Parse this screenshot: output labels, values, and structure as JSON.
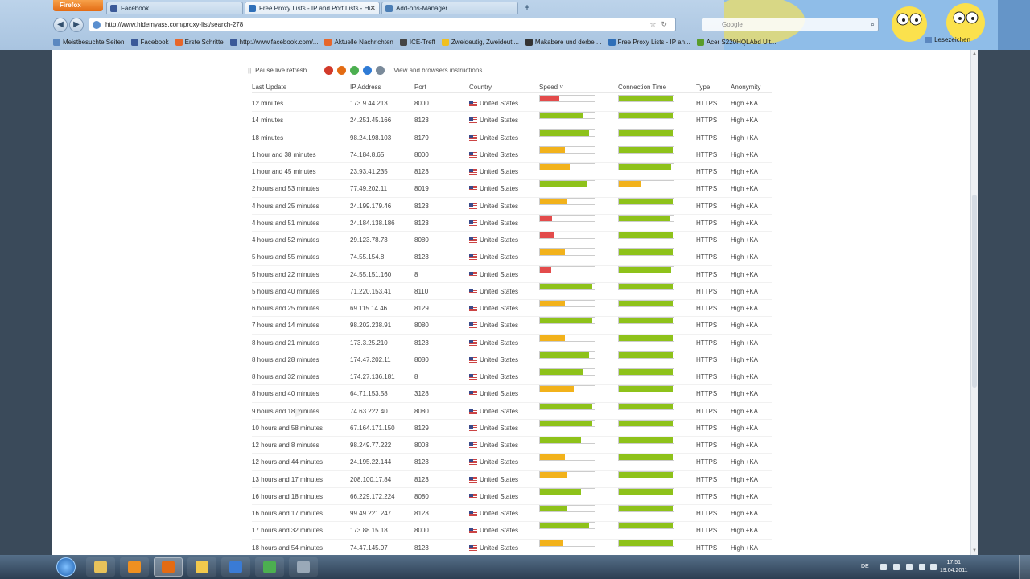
{
  "browser": {
    "app_button": "Firefox",
    "tabs": [
      {
        "label": "Facebook",
        "color": "#3b5998",
        "active": false
      },
      {
        "label": "Free Proxy Lists - IP and Port Lists - Hi...",
        "color": "#2f6fb8",
        "active": true
      },
      {
        "label": "Add-ons-Manager",
        "color": "#4a7db5",
        "active": false
      }
    ],
    "new_tab": "+",
    "url": "http://www.hidemyass.com/proxy-list/search-278",
    "search_placeholder": "Google",
    "back": "◀",
    "forward": "▶",
    "reload": "↻",
    "bookmarks": [
      {
        "label": "Meistbesuchte Seiten",
        "color": "#5b88c0"
      },
      {
        "label": "Facebook",
        "color": "#3b5998"
      },
      {
        "label": "Erste Schritte",
        "color": "#e7662a"
      },
      {
        "label": "http://www.facebook.com/...",
        "color": "#3b5998"
      },
      {
        "label": "Aktuelle Nachrichten",
        "color": "#e7662a"
      },
      {
        "label": "ICE-Treff",
        "color": "#444444"
      },
      {
        "label": "Zweideutig, Zweideuti...",
        "color": "#f0c020"
      },
      {
        "label": "Makabere und derbe ...",
        "color": "#333333"
      },
      {
        "label": "Free Proxy Lists - IP an...",
        "color": "#2f6fb8"
      },
      {
        "label": "Acer S220HQLAbd Ult...",
        "color": "#5a9c2a"
      }
    ],
    "bookmarks_right": "Lesezeichen",
    "theme_title": "The Simpsons"
  },
  "page": {
    "controls": {
      "pause_label": "Pause live refresh",
      "view_label": "View and browsers instructions"
    },
    "columns": [
      "Last Update",
      "IP Address",
      "Port",
      "Country",
      "Speed",
      "Connection Time",
      "Type",
      "Anonymity"
    ],
    "speed_sort_indicator": "Speed ˅",
    "rows": [
      {
        "update": "12 minutes",
        "ip": "173.9.44.213",
        "port": "8000",
        "country": "United States",
        "speed": 0.35,
        "speed_color": "#e34b4b",
        "conn": 0.98,
        "conn_color": "#8ec21a",
        "type": "HTTPS",
        "anon": "High +KA"
      },
      {
        "update": "14 minutes",
        "ip": "24.251.45.166",
        "port": "8123",
        "country": "United States",
        "speed": 0.78,
        "speed_color": "#8ec21a",
        "conn": 0.98,
        "conn_color": "#8ec21a",
        "type": "HTTPS",
        "anon": "High +KA"
      },
      {
        "update": "18 minutes",
        "ip": "98.24.198.103",
        "port": "8179",
        "country": "United States",
        "speed": 0.9,
        "speed_color": "#8ec21a",
        "conn": 0.98,
        "conn_color": "#8ec21a",
        "type": "HTTPS",
        "anon": "High +KA"
      },
      {
        "update": "1 hour and 38 minutes",
        "ip": "74.184.8.65",
        "port": "8000",
        "country": "United States",
        "speed": 0.45,
        "speed_color": "#f2b21b",
        "conn": 0.98,
        "conn_color": "#8ec21a",
        "type": "HTTPS",
        "anon": "High +KA"
      },
      {
        "update": "1 hour and 45 minutes",
        "ip": "23.93.41.235",
        "port": "8123",
        "country": "United States",
        "speed": 0.55,
        "speed_color": "#f2b21b",
        "conn": 0.95,
        "conn_color": "#8ec21a",
        "type": "HTTPS",
        "anon": "High +KA"
      },
      {
        "update": "2 hours and 53 minutes",
        "ip": "77.49.202.11",
        "port": "8019",
        "country": "United States",
        "speed": 0.85,
        "speed_color": "#8ec21a",
        "conn": 0.4,
        "conn_color": "#f2b21b",
        "type": "HTTPS",
        "anon": "High +KA"
      },
      {
        "update": "4 hours and 25 minutes",
        "ip": "24.199.179.46",
        "port": "8123",
        "country": "United States",
        "speed": 0.48,
        "speed_color": "#f2b21b",
        "conn": 0.98,
        "conn_color": "#8ec21a",
        "type": "HTTPS",
        "anon": "High +KA"
      },
      {
        "update": "4 hours and 51 minutes",
        "ip": "24.184.138.186",
        "port": "8123",
        "country": "United States",
        "speed": 0.22,
        "speed_color": "#e34b4b",
        "conn": 0.92,
        "conn_color": "#8ec21a",
        "type": "HTTPS",
        "anon": "High +KA"
      },
      {
        "update": "4 hours and 52 minutes",
        "ip": "29.123.78.73",
        "port": "8080",
        "country": "United States",
        "speed": 0.25,
        "speed_color": "#e34b4b",
        "conn": 0.98,
        "conn_color": "#8ec21a",
        "type": "HTTPS",
        "anon": "High +KA"
      },
      {
        "update": "5 hours and 55 minutes",
        "ip": "74.55.154.8",
        "port": "8123",
        "country": "United States",
        "speed": 0.45,
        "speed_color": "#f2b21b",
        "conn": 0.98,
        "conn_color": "#8ec21a",
        "type": "HTTPS",
        "anon": "High +KA"
      },
      {
        "update": "5 hours and 22 minutes",
        "ip": "24.55.151.160",
        "port": "8",
        "country": "United States",
        "speed": 0.2,
        "speed_color": "#e34b4b",
        "conn": 0.95,
        "conn_color": "#8ec21a",
        "type": "HTTPS",
        "anon": "High +KA"
      },
      {
        "update": "5 hours and 40 minutes",
        "ip": "71.220.153.41",
        "port": "8110",
        "country": "United States",
        "speed": 0.95,
        "speed_color": "#8ec21a",
        "conn": 0.98,
        "conn_color": "#8ec21a",
        "type": "HTTPS",
        "anon": "High +KA"
      },
      {
        "update": "6 hours and 25 minutes",
        "ip": "69.115.14.46",
        "port": "8129",
        "country": "United States",
        "speed": 0.45,
        "speed_color": "#f2b21b",
        "conn": 0.98,
        "conn_color": "#8ec21a",
        "type": "HTTPS",
        "anon": "High +KA"
      },
      {
        "update": "7 hours and 14 minutes",
        "ip": "98.202.238.91",
        "port": "8080",
        "country": "United States",
        "speed": 0.95,
        "speed_color": "#8ec21a",
        "conn": 0.98,
        "conn_color": "#8ec21a",
        "type": "HTTPS",
        "anon": "High +KA"
      },
      {
        "update": "8 hours and 21 minutes",
        "ip": "173.3.25.210",
        "port": "8123",
        "country": "United States",
        "speed": 0.45,
        "speed_color": "#f2b21b",
        "conn": 0.98,
        "conn_color": "#8ec21a",
        "type": "HTTPS",
        "anon": "High +KA"
      },
      {
        "update": "8 hours and 28 minutes",
        "ip": "174.47.202.11",
        "port": "8080",
        "country": "United States",
        "speed": 0.9,
        "speed_color": "#8ec21a",
        "conn": 0.98,
        "conn_color": "#8ec21a",
        "type": "HTTPS",
        "anon": "High +KA"
      },
      {
        "update": "8 hours and 32 minutes",
        "ip": "174.27.136.181",
        "port": "8",
        "country": "United States",
        "speed": 0.8,
        "speed_color": "#8ec21a",
        "conn": 0.98,
        "conn_color": "#8ec21a",
        "type": "HTTPS",
        "anon": "High +KA"
      },
      {
        "update": "8 hours and 40 minutes",
        "ip": "64.71.153.58",
        "port": "3128",
        "country": "United States",
        "speed": 0.62,
        "speed_color": "#f2b21b",
        "conn": 0.98,
        "conn_color": "#8ec21a",
        "type": "HTTPS",
        "anon": "High +KA"
      },
      {
        "update": "9 hours and 18 minutes",
        "ip": "74.63.222.40",
        "port": "8080",
        "country": "United States",
        "speed": 0.95,
        "speed_color": "#8ec21a",
        "conn": 0.98,
        "conn_color": "#8ec21a",
        "type": "HTTPS",
        "anon": "High +KA"
      },
      {
        "update": "10 hours and 58 minutes",
        "ip": "67.164.171.150",
        "port": "8129",
        "country": "United States",
        "speed": 0.95,
        "speed_color": "#8ec21a",
        "conn": 0.98,
        "conn_color": "#8ec21a",
        "type": "HTTPS",
        "anon": "High +KA"
      },
      {
        "update": "12 hours and 8 minutes",
        "ip": "98.249.77.222",
        "port": "8008",
        "country": "United States",
        "speed": 0.75,
        "speed_color": "#8ec21a",
        "conn": 0.98,
        "conn_color": "#8ec21a",
        "type": "HTTPS",
        "anon": "High +KA"
      },
      {
        "update": "12 hours and 44 minutes",
        "ip": "24.195.22.144",
        "port": "8123",
        "country": "United States",
        "speed": 0.45,
        "speed_color": "#f2b21b",
        "conn": 0.98,
        "conn_color": "#8ec21a",
        "type": "HTTPS",
        "anon": "High +KA"
      },
      {
        "update": "13 hours and 17 minutes",
        "ip": "208.100.17.84",
        "port": "8123",
        "country": "United States",
        "speed": 0.48,
        "speed_color": "#f2b21b",
        "conn": 0.98,
        "conn_color": "#8ec21a",
        "type": "HTTPS",
        "anon": "High +KA"
      },
      {
        "update": "16 hours and 18 minutes",
        "ip": "66.229.172.224",
        "port": "8080",
        "country": "United States",
        "speed": 0.75,
        "speed_color": "#8ec21a",
        "conn": 0.98,
        "conn_color": "#8ec21a",
        "type": "HTTPS",
        "anon": "High +KA"
      },
      {
        "update": "16 hours and 17 minutes",
        "ip": "99.49.221.247",
        "port": "8123",
        "country": "United States",
        "speed": 0.48,
        "speed_color": "#8ec21a",
        "conn": 0.98,
        "conn_color": "#8ec21a",
        "type": "HTTPS",
        "anon": "High +KA"
      },
      {
        "update": "17 hours and 32 minutes",
        "ip": "173.88.15.18",
        "port": "8000",
        "country": "United States",
        "speed": 0.9,
        "speed_color": "#8ec21a",
        "conn": 0.98,
        "conn_color": "#8ec21a",
        "type": "HTTPS",
        "anon": "High +KA"
      },
      {
        "update": "18 hours and 54 minutes",
        "ip": "74.47.145.97",
        "port": "8123",
        "country": "United States",
        "speed": 0.42,
        "speed_color": "#f2b21b",
        "conn": 0.98,
        "conn_color": "#8ec21a",
        "type": "HTTPS",
        "anon": "High +KA"
      }
    ]
  },
  "taskbar": {
    "apps": [
      {
        "name": "taskbar-explorer",
        "color": "#e8c25a",
        "active": false
      },
      {
        "name": "taskbar-media-player",
        "color": "#f09020",
        "active": false
      },
      {
        "name": "taskbar-firefox",
        "color": "#e36b13",
        "active": true
      },
      {
        "name": "taskbar-folder",
        "color": "#f2c94c",
        "active": false
      },
      {
        "name": "taskbar-app-blue",
        "color": "#3a7bd5",
        "active": false
      },
      {
        "name": "taskbar-chrome",
        "color": "#4caf50",
        "active": false
      },
      {
        "name": "taskbar-app-grey",
        "color": "#9aa9b8",
        "active": false
      }
    ],
    "language": "DE",
    "time": "17:51",
    "date": "19.04.2011"
  }
}
